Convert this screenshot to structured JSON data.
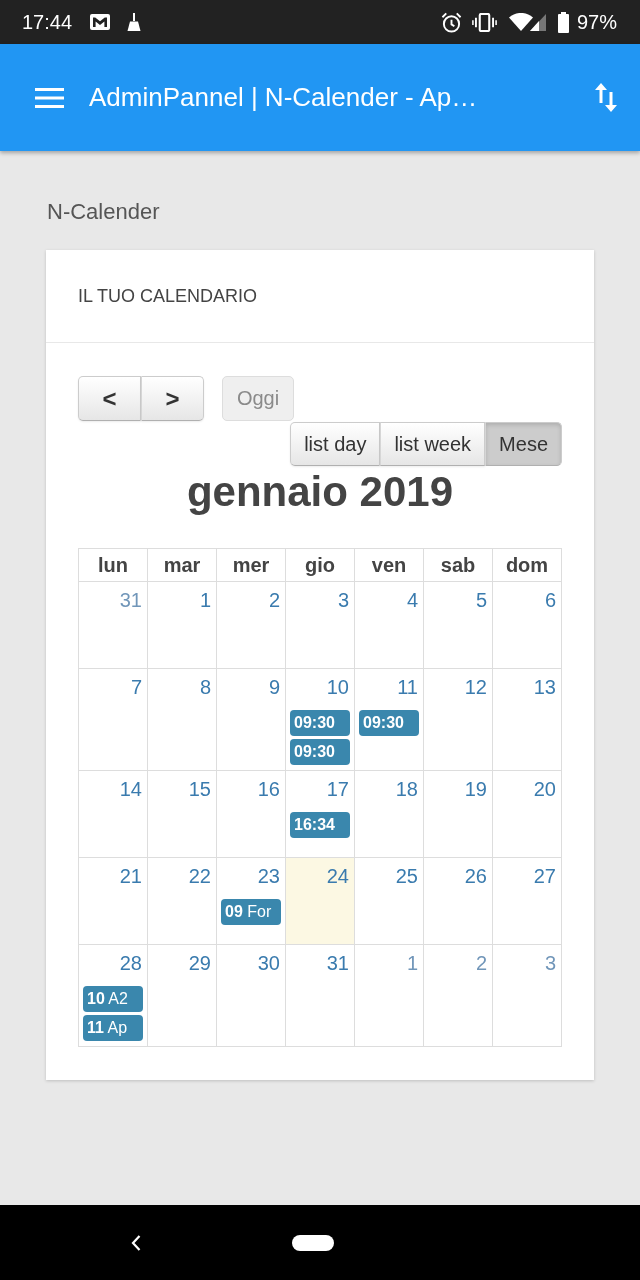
{
  "status_bar": {
    "time": "17:44",
    "battery_percent": "97%"
  },
  "app_bar": {
    "title": "AdminPannel | N-Calender - Ap…"
  },
  "page": {
    "heading": "N-Calender"
  },
  "card": {
    "title": "IL TUO CALENDARIO"
  },
  "calendar": {
    "nav_buttons": [
      {
        "label": "<"
      },
      {
        "label": ">"
      }
    ],
    "today_button": {
      "label": "Oggi",
      "disabled": true
    },
    "views": [
      {
        "label": "list day",
        "selected": false
      },
      {
        "label": "list week",
        "selected": false
      },
      {
        "label": "Mese",
        "selected": true
      }
    ],
    "title": "gennaio 2019",
    "weekdays": [
      "lun",
      "mar",
      "mer",
      "gio",
      "ven",
      "sab",
      "dom"
    ],
    "weeks": [
      {
        "days": [
          {
            "number": "31",
            "other_month": true,
            "today": false
          },
          {
            "number": "1",
            "other_month": false,
            "today": false
          },
          {
            "number": "2",
            "other_month": false,
            "today": false
          },
          {
            "number": "3",
            "other_month": false,
            "today": false
          },
          {
            "number": "4",
            "other_month": false,
            "today": false
          },
          {
            "number": "5",
            "other_month": false,
            "today": false
          },
          {
            "number": "6",
            "other_month": false,
            "today": false
          }
        ]
      },
      {
        "days": [
          {
            "number": "7",
            "other_month": false,
            "today": false
          },
          {
            "number": "8",
            "other_month": false,
            "today": false
          },
          {
            "number": "9",
            "other_month": false,
            "today": false
          },
          {
            "number": "10",
            "other_month": false,
            "today": false,
            "events": [
              {
                "time": "09:30"
              },
              {
                "time": "09:30"
              }
            ]
          },
          {
            "number": "11",
            "other_month": false,
            "today": false,
            "events": [
              {
                "time": "09:30"
              }
            ]
          },
          {
            "number": "12",
            "other_month": false,
            "today": false
          },
          {
            "number": "13",
            "other_month": false,
            "today": false
          }
        ]
      },
      {
        "days": [
          {
            "number": "14",
            "other_month": false,
            "today": false
          },
          {
            "number": "15",
            "other_month": false,
            "today": false
          },
          {
            "number": "16",
            "other_month": false,
            "today": false
          },
          {
            "number": "17",
            "other_month": false,
            "today": false,
            "events": [
              {
                "time": "16:34"
              }
            ]
          },
          {
            "number": "18",
            "other_month": false,
            "today": false
          },
          {
            "number": "19",
            "other_month": false,
            "today": false
          },
          {
            "number": "20",
            "other_month": false,
            "today": false
          }
        ]
      },
      {
        "days": [
          {
            "number": "21",
            "other_month": false,
            "today": false
          },
          {
            "number": "22",
            "other_month": false,
            "today": false
          },
          {
            "number": "23",
            "other_month": false,
            "today": false,
            "events": [
              {
                "time": "09",
                "title": "For"
              }
            ]
          },
          {
            "number": "24",
            "other_month": false,
            "today": true
          },
          {
            "number": "25",
            "other_month": false,
            "today": false
          },
          {
            "number": "26",
            "other_month": false,
            "today": false
          },
          {
            "number": "27",
            "other_month": false,
            "today": false
          }
        ]
      },
      {
        "days": [
          {
            "number": "28",
            "other_month": false,
            "today": false,
            "events": [
              {
                "time": "10",
                "title": "A2"
              },
              {
                "time": "11",
                "title": "Ap"
              }
            ]
          },
          {
            "number": "29",
            "other_month": false,
            "today": false
          },
          {
            "number": "30",
            "other_month": false,
            "today": false
          },
          {
            "number": "31",
            "other_month": false,
            "today": false
          },
          {
            "number": "1",
            "other_month": true,
            "today": false
          },
          {
            "number": "2",
            "other_month": true,
            "today": false
          },
          {
            "number": "3",
            "other_month": true,
            "today": false
          }
        ]
      }
    ]
  }
}
